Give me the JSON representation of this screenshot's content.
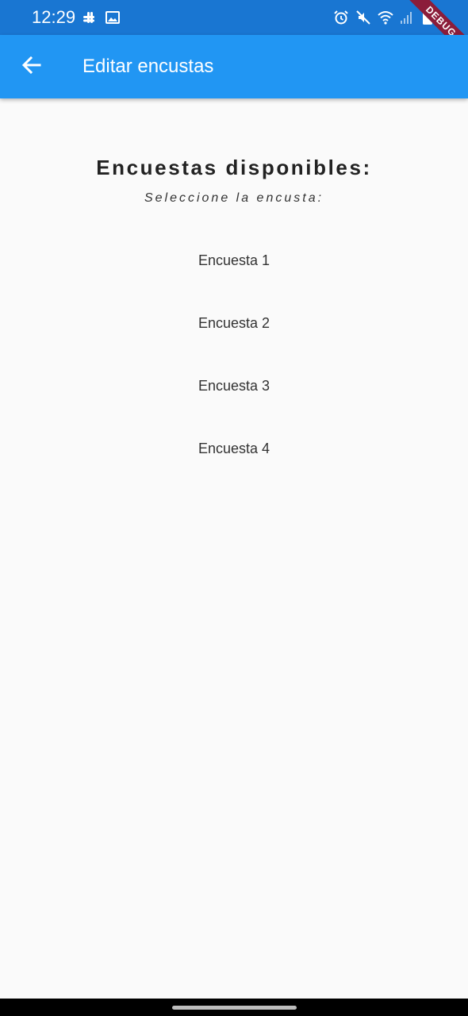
{
  "status_bar": {
    "time": "12:29",
    "left_icons": [
      "slack-icon",
      "image-icon"
    ],
    "right_icons": [
      "alarm-icon",
      "mute-icon",
      "wifi-icon",
      "signal-icon",
      "battery-icon"
    ]
  },
  "debug_banner": "DEBUG",
  "app_bar": {
    "back_icon": "arrow-left-icon",
    "title": "Editar encustas"
  },
  "content": {
    "heading": "Encuestas disponibles:",
    "subheading": "Seleccione la encusta:",
    "surveys": [
      {
        "label": "Encuesta 1"
      },
      {
        "label": "Encuesta 2"
      },
      {
        "label": "Encuesta 3"
      },
      {
        "label": "Encuesta 4"
      }
    ]
  },
  "colors": {
    "status_bar": "#1976d2",
    "app_bar": "#2196f3",
    "background": "#fafafa"
  }
}
